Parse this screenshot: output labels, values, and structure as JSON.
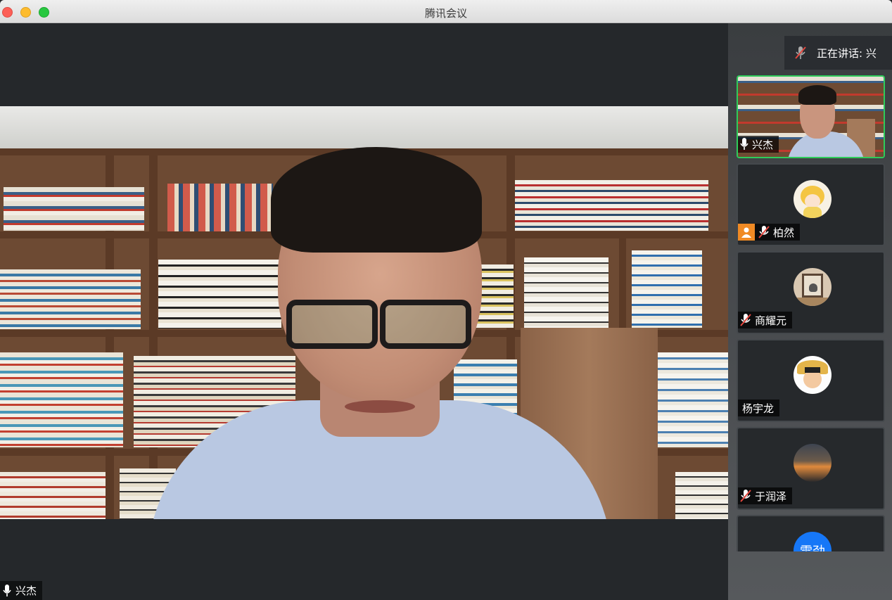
{
  "window": {
    "title": "腾讯会议"
  },
  "speaking": {
    "label": "正在讲话: 兴"
  },
  "main_video": {
    "participant_name": "兴杰"
  },
  "participants": [
    {
      "name": "兴杰",
      "mic": "on",
      "active": true,
      "video": true
    },
    {
      "name": "柏然",
      "mic": "muted",
      "host": true,
      "avatar": "cartoon-girl"
    },
    {
      "name": "商耀元",
      "mic": "muted",
      "avatar": "cat-window"
    },
    {
      "name": "杨宇龙",
      "mic": "none",
      "avatar": "straw-hat-cartoon"
    },
    {
      "name": "于润泽",
      "mic": "muted",
      "avatar": "sunset-sky"
    },
    {
      "name": "",
      "avatar": "blue-circle",
      "avatar_text": "雷劲"
    }
  ],
  "colors": {
    "active_border": "#2ecc5a",
    "host_badge": "#f08a24",
    "mute_red": "#e5483f"
  }
}
